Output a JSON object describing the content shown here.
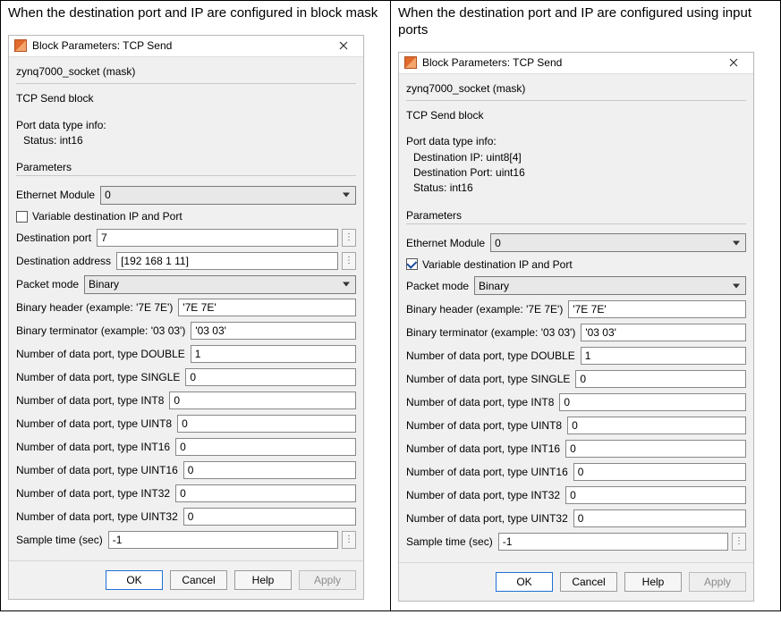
{
  "left": {
    "caption": "When the destination port and IP are configured in block mask",
    "dialog_title": "Block Parameters: TCP Send",
    "mask_line": "zynq7000_socket (mask)",
    "block_desc": "TCP Send block",
    "port_info_header": "Port data type info:",
    "port_info_lines": [
      "Status: int16"
    ],
    "parameters_label": "Parameters",
    "ethernet_label": "Ethernet Module",
    "ethernet_value": "0",
    "var_dest_label": "Variable destination IP and Port",
    "var_dest_checked": false,
    "dest_port_label": "Destination port",
    "dest_port_value": "7",
    "dest_addr_label": "Destination address",
    "dest_addr_value": "[192 168 1 11]",
    "packet_mode_label": "Packet mode",
    "packet_mode_value": "Binary",
    "bin_header_label": "Binary header (example: '7E 7E')",
    "bin_header_value": "'7E 7E'",
    "bin_term_label": "Binary terminator (example: '03 03')",
    "bin_term_value": "'03 03'",
    "ports": [
      {
        "label": "Number of data port, type DOUBLE",
        "value": "1"
      },
      {
        "label": "Number of data port, type SINGLE",
        "value": "0"
      },
      {
        "label": "Number of data port, type INT8",
        "value": "0"
      },
      {
        "label": "Number of data port, type UINT8",
        "value": "0"
      },
      {
        "label": "Number of data port, type INT16",
        "value": "0"
      },
      {
        "label": "Number of data port, type UINT16",
        "value": "0"
      },
      {
        "label": "Number of data port, type INT32",
        "value": "0"
      },
      {
        "label": "Number of data port, type UINT32",
        "value": "0"
      }
    ],
    "sample_time_label": "Sample time (sec)",
    "sample_time_value": "-1",
    "buttons": {
      "ok": "OK",
      "cancel": "Cancel",
      "help": "Help",
      "apply": "Apply"
    }
  },
  "right": {
    "caption": "When the destination port and IP are configured using input ports",
    "dialog_title": "Block Parameters: TCP Send",
    "mask_line": "zynq7000_socket (mask)",
    "block_desc": "TCP Send block",
    "port_info_header": "Port data type info:",
    "port_info_lines": [
      "Destination IP: uint8[4]",
      "Destination Port: uint16",
      "Status: int16"
    ],
    "parameters_label": "Parameters",
    "ethernet_label": "Ethernet Module",
    "ethernet_value": "0",
    "var_dest_label": "Variable destination IP and Port",
    "var_dest_checked": true,
    "packet_mode_label": "Packet mode",
    "packet_mode_value": "Binary",
    "bin_header_label": "Binary header (example: '7E 7E')",
    "bin_header_value": "'7E 7E'",
    "bin_term_label": "Binary terminator (example: '03 03')",
    "bin_term_value": "'03 03'",
    "ports": [
      {
        "label": "Number of data port, type DOUBLE",
        "value": "1"
      },
      {
        "label": "Number of data port, type SINGLE",
        "value": "0"
      },
      {
        "label": "Number of data port, type INT8",
        "value": "0"
      },
      {
        "label": "Number of data port, type UINT8",
        "value": "0"
      },
      {
        "label": "Number of data port, type INT16",
        "value": "0"
      },
      {
        "label": "Number of data port, type UINT16",
        "value": "0"
      },
      {
        "label": "Number of data port, type INT32",
        "value": "0"
      },
      {
        "label": "Number of data port, type UINT32",
        "value": "0"
      }
    ],
    "sample_time_label": "Sample time (sec)",
    "sample_time_value": "-1",
    "buttons": {
      "ok": "OK",
      "cancel": "Cancel",
      "help": "Help",
      "apply": "Apply"
    }
  }
}
